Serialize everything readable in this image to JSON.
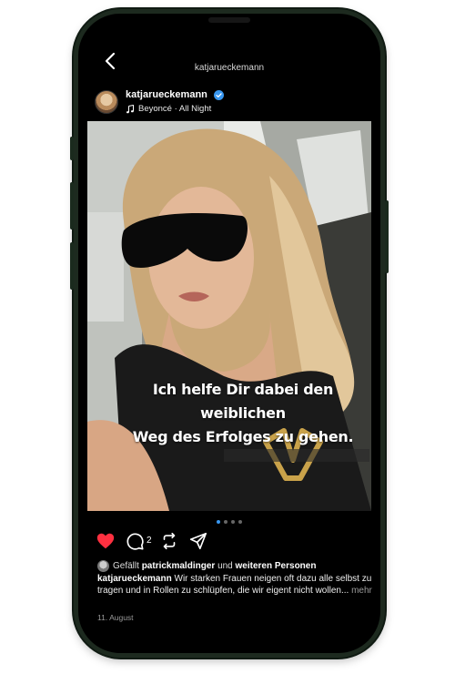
{
  "header": {
    "title": "katjarueckemann"
  },
  "post": {
    "username": "katjarueckemann",
    "music": "Beyoncé · All Night",
    "overlay_line1": "Ich helfe Dir dabei den weiblichen",
    "overlay_line2": "Weg des Erfolges zu gehen.",
    "comment_count": "2",
    "carousel": {
      "total": 4,
      "active_index": 0
    },
    "liked": true
  },
  "likes": {
    "prefix": "Gefällt",
    "user": "patrickmaldinger",
    "middle": "und",
    "others": "weiteren Personen"
  },
  "caption": {
    "user": "katjarueckemann",
    "text": "Wir starken Frauen neigen oft dazu alle selbst zu tragen und in Rollen zu schlüpfen, die wir eigent nicht wollen...",
    "more": "mehr"
  },
  "date": "11. August",
  "colors": {
    "like_red": "#ff3040",
    "verified_blue": "#3897f0",
    "phone_frame": "#1d2a1f"
  }
}
